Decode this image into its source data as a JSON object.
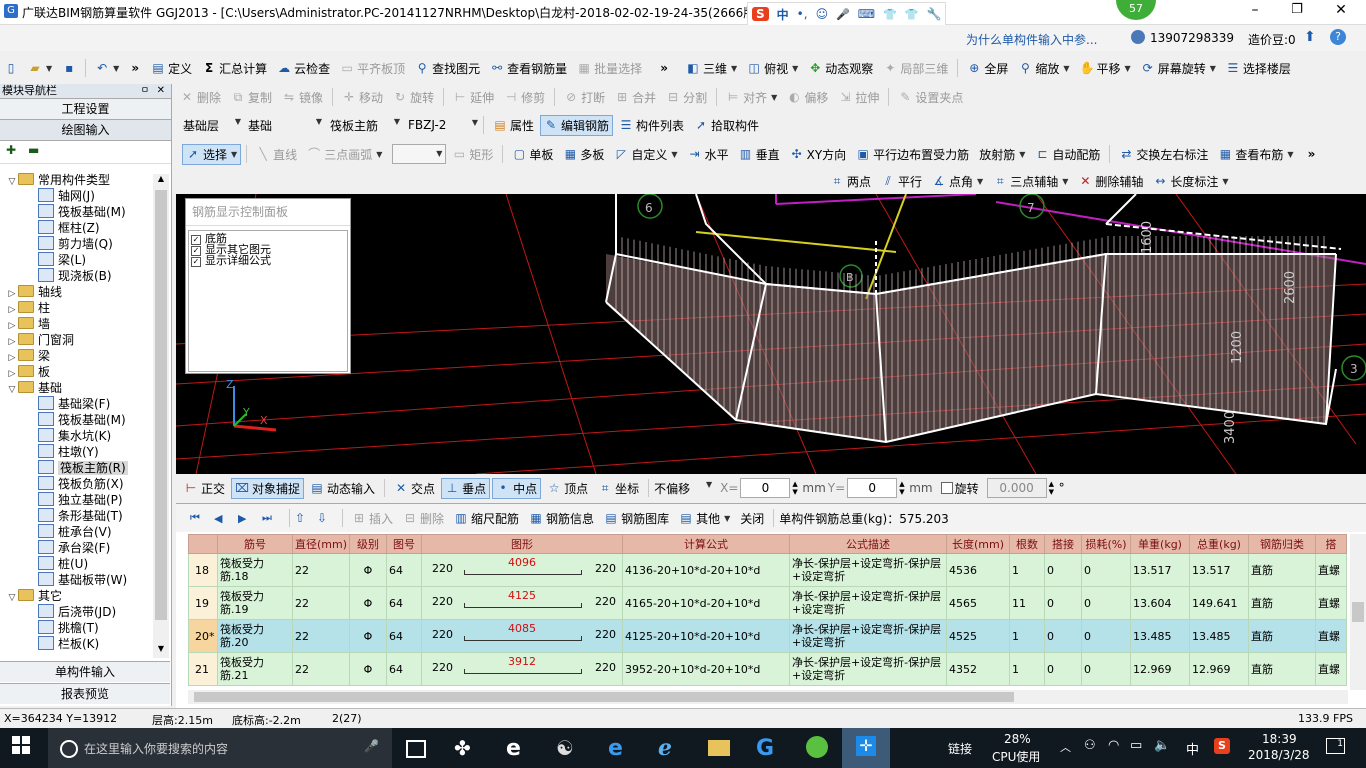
{
  "window": {
    "title": "广联达BIM钢筋算量软件 GGJ2013 - [C:\\Users\\Administrator.PC-20141127NRHM\\Desktop\\白龙村-2018-02-02-19-24-35(2666版",
    "minimize": "–",
    "maximize": "❐",
    "close": "✕"
  },
  "ime": {
    "brand": "S",
    "items": [
      "中",
      "•,",
      "☺",
      "🎤",
      "⌨",
      "👕",
      "👕",
      "🔧"
    ]
  },
  "notify": {
    "badge_count": "57",
    "question": "为什么单构件输入中参...",
    "phone": "13907298339",
    "beans": "造价豆:0"
  },
  "toolbar1": {
    "items": [
      "定义",
      "汇总计算",
      "云检查",
      "平齐板顶",
      "查找图元",
      "查看钢筋量",
      "批量选择"
    ],
    "view_items": [
      "三维",
      "俯视",
      "动态观察",
      "局部三维",
      "全屏",
      "缩放",
      "平移",
      "屏幕旋转",
      "选择楼层"
    ]
  },
  "toolbar2": {
    "items": [
      "删除",
      "复制",
      "镜像",
      "移动",
      "旋转",
      "延伸",
      "修剪",
      "打断",
      "合并",
      "分割",
      "对齐",
      "偏移",
      "拉伸",
      "设置夹点"
    ]
  },
  "toolbar3": {
    "floor": "基础层",
    "category": "基础",
    "type": "筏板主筋",
    "name": "FBZJ-2",
    "items": [
      "属性",
      "编辑钢筋",
      "构件列表",
      "拾取构件"
    ]
  },
  "toolbar4": {
    "items": [
      "选择",
      "直线",
      "三点画弧",
      "矩形",
      "单板",
      "多板",
      "自定义",
      "水平",
      "垂直",
      "XY方向",
      "平行边布置受力筋",
      "放射筋",
      "自动配筋",
      "交换左右标注",
      "查看布筋"
    ]
  },
  "toolbar5": {
    "items": [
      "两点",
      "平行",
      "点角",
      "三点辅轴",
      "删除辅轴",
      "长度标注"
    ]
  },
  "sidebar": {
    "title": "模块导航栏",
    "pin": "ㅁ",
    "close": "✕",
    "nav_buttons": [
      "工程设置",
      "绘图输入"
    ],
    "tree": [
      {
        "label": "常用构件类型",
        "level": 0,
        "kind": "folder",
        "expanded": true
      },
      {
        "label": "轴网(J)",
        "level": 1,
        "kind": "leaf"
      },
      {
        "label": "筏板基础(M)",
        "level": 1,
        "kind": "leaf"
      },
      {
        "label": "框柱(Z)",
        "level": 1,
        "kind": "leaf"
      },
      {
        "label": "剪力墙(Q)",
        "level": 1,
        "kind": "leaf"
      },
      {
        "label": "梁(L)",
        "level": 1,
        "kind": "leaf"
      },
      {
        "label": "现浇板(B)",
        "level": 1,
        "kind": "leaf"
      },
      {
        "label": "轴线",
        "level": 0,
        "kind": "folder",
        "expanded": false
      },
      {
        "label": "柱",
        "level": 0,
        "kind": "folder",
        "expanded": false
      },
      {
        "label": "墙",
        "level": 0,
        "kind": "folder",
        "expanded": false
      },
      {
        "label": "门窗洞",
        "level": 0,
        "kind": "folder",
        "expanded": false
      },
      {
        "label": "梁",
        "level": 0,
        "kind": "folder",
        "expanded": false
      },
      {
        "label": "板",
        "level": 0,
        "kind": "folder",
        "expanded": false
      },
      {
        "label": "基础",
        "level": 0,
        "kind": "folder",
        "expanded": true
      },
      {
        "label": "基础梁(F)",
        "level": 1,
        "kind": "leaf"
      },
      {
        "label": "筏板基础(M)",
        "level": 1,
        "kind": "leaf"
      },
      {
        "label": "集水坑(K)",
        "level": 1,
        "kind": "leaf"
      },
      {
        "label": "柱墩(Y)",
        "level": 1,
        "kind": "leaf"
      },
      {
        "label": "筏板主筋(R)",
        "level": 1,
        "kind": "leaf",
        "selected": true
      },
      {
        "label": "筏板负筋(X)",
        "level": 1,
        "kind": "leaf"
      },
      {
        "label": "独立基础(P)",
        "level": 1,
        "kind": "leaf"
      },
      {
        "label": "条形基础(T)",
        "level": 1,
        "kind": "leaf"
      },
      {
        "label": "桩承台(V)",
        "level": 1,
        "kind": "leaf"
      },
      {
        "label": "承台梁(F)",
        "level": 1,
        "kind": "leaf"
      },
      {
        "label": "桩(U)",
        "level": 1,
        "kind": "leaf"
      },
      {
        "label": "基础板带(W)",
        "level": 1,
        "kind": "leaf"
      },
      {
        "label": "其它",
        "level": 0,
        "kind": "folder",
        "expanded": true
      },
      {
        "label": "后浇带(JD)",
        "level": 1,
        "kind": "leaf"
      },
      {
        "label": "挑檐(T)",
        "level": 1,
        "kind": "leaf"
      },
      {
        "label": "栏板(K)",
        "level": 1,
        "kind": "leaf"
      }
    ],
    "bottom_buttons": [
      "单构件输入",
      "报表预览"
    ]
  },
  "panel": {
    "title": "钢筋显示控制面板",
    "options": [
      "底筋",
      "显示其它图元",
      "显示详细公式"
    ]
  },
  "viewport": {
    "axis_labels": [
      "6",
      "7",
      "B",
      "3"
    ],
    "dims": [
      "1600",
      "2600",
      "1200",
      "3400"
    ],
    "axes": [
      "Z",
      "Y",
      "X"
    ]
  },
  "snapbar": {
    "items": [
      "正交",
      "对象捕捉",
      "动态输入",
      "交点",
      "垂点",
      "中点",
      "顶点",
      "坐标"
    ],
    "offset_mode": "不偏移",
    "x_label": "X=",
    "x_value": "0",
    "y_label": "Y=",
    "y_value": "0",
    "unit": "mm",
    "rotate_label": "旋转",
    "rotate_value": "0.000",
    "degree": "°"
  },
  "rebar_toolbar": {
    "items": [
      "插入",
      "删除",
      "缩尺配筋",
      "钢筋信息",
      "钢筋图库",
      "其他",
      "关闭"
    ],
    "total_label": "单构件钢筋总重(kg)：575.203"
  },
  "table": {
    "headers": [
      "",
      "筋号",
      "直径(mm)",
      "级别",
      "图号",
      "图形",
      "计算公式",
      "公式描述",
      "长度(mm)",
      "根数",
      "搭接",
      "损耗(%)",
      "单重(kg)",
      "总重(kg)",
      "钢筋归类",
      "搭"
    ],
    "rows": [
      {
        "idx": "18",
        "name": "筏板受力筋.18",
        "dia": "22",
        "grade": "Φ",
        "fig_no": "64",
        "left": "220",
        "mid": "4096",
        "right": "220",
        "formula": "4136-20+10*d-20+10*d",
        "desc": "净长-保护层+设定弯折-保护层+设定弯折",
        "len": "4536",
        "count": "1",
        "lap": "0",
        "loss": "0",
        "unit_w": "13.517",
        "total_w": "13.517",
        "cat": "直筋",
        "extra": "直螺"
      },
      {
        "idx": "19",
        "name": "筏板受力筋.19",
        "dia": "22",
        "grade": "Φ",
        "fig_no": "64",
        "left": "220",
        "mid": "4125",
        "right": "220",
        "formula": "4165-20+10*d-20+10*d",
        "desc": "净长-保护层+设定弯折-保护层+设定弯折",
        "len": "4565",
        "count": "11",
        "lap": "0",
        "loss": "0",
        "unit_w": "13.604",
        "total_w": "149.641",
        "cat": "直筋",
        "extra": "直螺"
      },
      {
        "idx": "20*",
        "name": "筏板受力筋.20",
        "dia": "22",
        "grade": "Φ",
        "fig_no": "64",
        "left": "220",
        "mid": "4085",
        "right": "220",
        "formula": "4125-20+10*d-20+10*d",
        "desc": "净长-保护层+设定弯折-保护层+设定弯折",
        "len": "4525",
        "count": "1",
        "lap": "0",
        "loss": "0",
        "unit_w": "13.485",
        "total_w": "13.485",
        "cat": "直筋",
        "extra": "直螺",
        "selected": true
      },
      {
        "idx": "21",
        "name": "筏板受力筋.21",
        "dia": "22",
        "grade": "Φ",
        "fig_no": "64",
        "left": "220",
        "mid": "3912",
        "right": "220",
        "formula": "3952-20+10*d-20+10*d",
        "desc": "净长-保护层+设定弯折-保护层+设定弯折",
        "len": "4352",
        "count": "1",
        "lap": "0",
        "loss": "0",
        "unit_w": "12.969",
        "total_w": "12.969",
        "cat": "直筋",
        "extra": "直螺"
      }
    ]
  },
  "statusbar": {
    "coords": "X=364234 Y=13912",
    "floor_height": "层高:2.15m",
    "base_height": "底标高:-2.2m",
    "count": "2(27)",
    "fps": "133.9 FPS"
  },
  "taskbar": {
    "search_placeholder": "在这里输入你要搜索的内容",
    "link": "链接",
    "cpu_pct": "28%",
    "cpu_label": "CPU使用",
    "lang": "中",
    "time": "18:39",
    "date": "2018/3/28",
    "notifications": "1"
  }
}
